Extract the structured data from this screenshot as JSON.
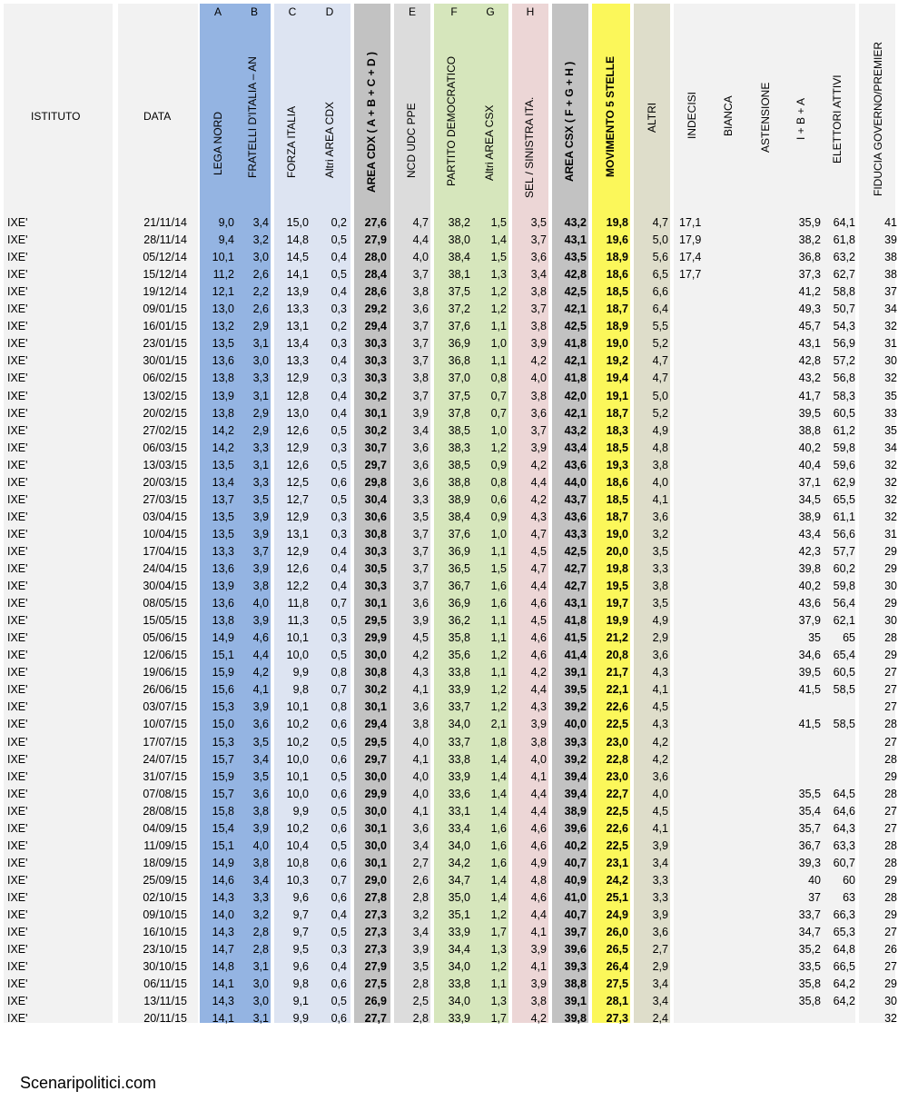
{
  "header": {
    "istituto": "ISTITUTO",
    "data": "DATA",
    "letters": {
      "A": "A",
      "B": "B",
      "C": "C",
      "D": "D",
      "E": "E",
      "F": "F",
      "G": "G",
      "H": "H"
    },
    "columns": {
      "lega": "LEGA NORD",
      "fdi": "FRATELLI D'ITALIA – AN",
      "fi": "FORZA ITALIA",
      "altri_cdx": "Altri AREA CDX",
      "area_cdx": "AREA CDX   ( A + B + C + D )",
      "ncd": "NCD UDC PPE",
      "pd": "PARTITO DEMOCRATICO",
      "altri_csx": "Altri AREA CSX",
      "sel": "SEL / SINISTRA ITA.",
      "area_csx": "AREA CSX   ( F + G + H )",
      "m5s": "MOVIMENTO 5 STELLE",
      "altri": "ALTRI",
      "indecisi": "INDECISI",
      "bianca": "BIANCA",
      "astensione": "ASTENSIONE",
      "iba": "I + B + A",
      "elettori": "ELETTORI ATTIVI",
      "fiducia": "FIDUCIA GOVERNO/PREMIER"
    }
  },
  "colors": {
    "lega_fdi": "#94b4e2",
    "fi_altri": "#dde4f2",
    "area_cdx": "#c2c2c2",
    "ncd": "#dcdcdc",
    "pd_altri": "#d6e6bc",
    "sel": "#ecd6d6",
    "area_csx": "#c2c2c2",
    "m5s": "#fbf75a",
    "altri": "#deddca",
    "right_bg": "#f2f2f2"
  },
  "rows": [
    [
      "IXE'",
      "21/11/14",
      "9,0",
      "3,4",
      "15,0",
      "0,2",
      "27,6",
      "4,7",
      "38,2",
      "1,5",
      "3,5",
      "43,2",
      "19,8",
      "4,7",
      "17,1",
      "",
      "",
      "35,9",
      "64,1",
      "41"
    ],
    [
      "IXE'",
      "28/11/14",
      "9,4",
      "3,2",
      "14,8",
      "0,5",
      "27,9",
      "4,4",
      "38,0",
      "1,4",
      "3,7",
      "43,1",
      "19,6",
      "5,0",
      "17,9",
      "",
      "",
      "38,2",
      "61,8",
      "39"
    ],
    [
      "IXE'",
      "05/12/14",
      "10,1",
      "3,0",
      "14,5",
      "0,4",
      "28,0",
      "4,0",
      "38,4",
      "1,5",
      "3,6",
      "43,5",
      "18,9",
      "5,6",
      "17,4",
      "",
      "",
      "36,8",
      "63,2",
      "38"
    ],
    [
      "IXE'",
      "15/12/14",
      "11,2",
      "2,6",
      "14,1",
      "0,5",
      "28,4",
      "3,7",
      "38,1",
      "1,3",
      "3,4",
      "42,8",
      "18,6",
      "6,5",
      "17,7",
      "",
      "",
      "37,3",
      "62,7",
      "38"
    ],
    [
      "IXE'",
      "19/12/14",
      "12,1",
      "2,2",
      "13,9",
      "0,4",
      "28,6",
      "3,8",
      "37,5",
      "1,2",
      "3,8",
      "42,5",
      "18,5",
      "6,6",
      "",
      "",
      "",
      "41,2",
      "58,8",
      "37"
    ],
    [
      "IXE'",
      "09/01/15",
      "13,0",
      "2,6",
      "13,3",
      "0,3",
      "29,2",
      "3,6",
      "37,2",
      "1,2",
      "3,7",
      "42,1",
      "18,7",
      "6,4",
      "",
      "",
      "",
      "49,3",
      "50,7",
      "34"
    ],
    [
      "IXE'",
      "16/01/15",
      "13,2",
      "2,9",
      "13,1",
      "0,2",
      "29,4",
      "3,7",
      "37,6",
      "1,1",
      "3,8",
      "42,5",
      "18,9",
      "5,5",
      "",
      "",
      "",
      "45,7",
      "54,3",
      "32"
    ],
    [
      "IXE'",
      "23/01/15",
      "13,5",
      "3,1",
      "13,4",
      "0,3",
      "30,3",
      "3,7",
      "36,9",
      "1,0",
      "3,9",
      "41,8",
      "19,0",
      "5,2",
      "",
      "",
      "",
      "43,1",
      "56,9",
      "31"
    ],
    [
      "IXE'",
      "30/01/15",
      "13,6",
      "3,0",
      "13,3",
      "0,4",
      "30,3",
      "3,7",
      "36,8",
      "1,1",
      "4,2",
      "42,1",
      "19,2",
      "4,7",
      "",
      "",
      "",
      "42,8",
      "57,2",
      "30"
    ],
    [
      "IXE'",
      "06/02/15",
      "13,8",
      "3,3",
      "12,9",
      "0,3",
      "30,3",
      "3,8",
      "37,0",
      "0,8",
      "4,0",
      "41,8",
      "19,4",
      "4,7",
      "",
      "",
      "",
      "43,2",
      "56,8",
      "32"
    ],
    [
      "IXE'",
      "13/02/15",
      "13,9",
      "3,1",
      "12,8",
      "0,4",
      "30,2",
      "3,7",
      "37,5",
      "0,7",
      "3,8",
      "42,0",
      "19,1",
      "5,0",
      "",
      "",
      "",
      "41,7",
      "58,3",
      "35"
    ],
    [
      "IXE'",
      "20/02/15",
      "13,8",
      "2,9",
      "13,0",
      "0,4",
      "30,1",
      "3,9",
      "37,8",
      "0,7",
      "3,6",
      "42,1",
      "18,7",
      "5,2",
      "",
      "",
      "",
      "39,5",
      "60,5",
      "33"
    ],
    [
      "IXE'",
      "27/02/15",
      "14,2",
      "2,9",
      "12,6",
      "0,5",
      "30,2",
      "3,4",
      "38,5",
      "1,0",
      "3,7",
      "43,2",
      "18,3",
      "4,9",
      "",
      "",
      "",
      "38,8",
      "61,2",
      "35"
    ],
    [
      "IXE'",
      "06/03/15",
      "14,2",
      "3,3",
      "12,9",
      "0,3",
      "30,7",
      "3,6",
      "38,3",
      "1,2",
      "3,9",
      "43,4",
      "18,5",
      "4,8",
      "",
      "",
      "",
      "40,2",
      "59,8",
      "34"
    ],
    [
      "IXE'",
      "13/03/15",
      "13,5",
      "3,1",
      "12,6",
      "0,5",
      "29,7",
      "3,6",
      "38,5",
      "0,9",
      "4,2",
      "43,6",
      "19,3",
      "3,8",
      "",
      "",
      "",
      "40,4",
      "59,6",
      "32"
    ],
    [
      "IXE'",
      "20/03/15",
      "13,4",
      "3,3",
      "12,5",
      "0,6",
      "29,8",
      "3,6",
      "38,8",
      "0,8",
      "4,4",
      "44,0",
      "18,6",
      "4,0",
      "",
      "",
      "",
      "37,1",
      "62,9",
      "32"
    ],
    [
      "IXE'",
      "27/03/15",
      "13,7",
      "3,5",
      "12,7",
      "0,5",
      "30,4",
      "3,3",
      "38,9",
      "0,6",
      "4,2",
      "43,7",
      "18,5",
      "4,1",
      "",
      "",
      "",
      "34,5",
      "65,5",
      "32"
    ],
    [
      "IXE'",
      "03/04/15",
      "13,5",
      "3,9",
      "12,9",
      "0,3",
      "30,6",
      "3,5",
      "38,4",
      "0,9",
      "4,3",
      "43,6",
      "18,7",
      "3,6",
      "",
      "",
      "",
      "38,9",
      "61,1",
      "32"
    ],
    [
      "IXE'",
      "10/04/15",
      "13,5",
      "3,9",
      "13,1",
      "0,3",
      "30,8",
      "3,7",
      "37,6",
      "1,0",
      "4,7",
      "43,3",
      "19,0",
      "3,2",
      "",
      "",
      "",
      "43,4",
      "56,6",
      "31"
    ],
    [
      "IXE'",
      "17/04/15",
      "13,3",
      "3,7",
      "12,9",
      "0,4",
      "30,3",
      "3,7",
      "36,9",
      "1,1",
      "4,5",
      "42,5",
      "20,0",
      "3,5",
      "",
      "",
      "",
      "42,3",
      "57,7",
      "29"
    ],
    [
      "IXE'",
      "24/04/15",
      "13,6",
      "3,9",
      "12,6",
      "0,4",
      "30,5",
      "3,7",
      "36,5",
      "1,5",
      "4,7",
      "42,7",
      "19,8",
      "3,3",
      "",
      "",
      "",
      "39,8",
      "60,2",
      "29"
    ],
    [
      "IXE'",
      "30/04/15",
      "13,9",
      "3,8",
      "12,2",
      "0,4",
      "30,3",
      "3,7",
      "36,7",
      "1,6",
      "4,4",
      "42,7",
      "19,5",
      "3,8",
      "",
      "",
      "",
      "40,2",
      "59,8",
      "30"
    ],
    [
      "IXE'",
      "08/05/15",
      "13,6",
      "4,0",
      "11,8",
      "0,7",
      "30,1",
      "3,6",
      "36,9",
      "1,6",
      "4,6",
      "43,1",
      "19,7",
      "3,5",
      "",
      "",
      "",
      "43,6",
      "56,4",
      "29"
    ],
    [
      "IXE'",
      "15/05/15",
      "13,8",
      "3,9",
      "11,3",
      "0,5",
      "29,5",
      "3,9",
      "36,2",
      "1,1",
      "4,5",
      "41,8",
      "19,9",
      "4,9",
      "",
      "",
      "",
      "37,9",
      "62,1",
      "30"
    ],
    [
      "IXE'",
      "05/06/15",
      "14,9",
      "4,6",
      "10,1",
      "0,3",
      "29,9",
      "4,5",
      "35,8",
      "1,1",
      "4,6",
      "41,5",
      "21,2",
      "2,9",
      "",
      "",
      "",
      "35",
      "65",
      "28"
    ],
    [
      "IXE'",
      "12/06/15",
      "15,1",
      "4,4",
      "10,0",
      "0,5",
      "30,0",
      "4,2",
      "35,6",
      "1,2",
      "4,6",
      "41,4",
      "20,8",
      "3,6",
      "",
      "",
      "",
      "34,6",
      "65,4",
      "29"
    ],
    [
      "IXE'",
      "19/06/15",
      "15,9",
      "4,2",
      "9,9",
      "0,8",
      "30,8",
      "4,3",
      "33,8",
      "1,1",
      "4,2",
      "39,1",
      "21,7",
      "4,3",
      "",
      "",
      "",
      "39,5",
      "60,5",
      "27"
    ],
    [
      "IXE'",
      "26/06/15",
      "15,6",
      "4,1",
      "9,8",
      "0,7",
      "30,2",
      "4,1",
      "33,9",
      "1,2",
      "4,4",
      "39,5",
      "22,1",
      "4,1",
      "",
      "",
      "",
      "41,5",
      "58,5",
      "27"
    ],
    [
      "IXE'",
      "03/07/15",
      "15,3",
      "3,9",
      "10,1",
      "0,8",
      "30,1",
      "3,6",
      "33,7",
      "1,2",
      "4,3",
      "39,2",
      "22,6",
      "4,5",
      "",
      "",
      "",
      "",
      "",
      "27"
    ],
    [
      "IXE'",
      "10/07/15",
      "15,0",
      "3,6",
      "10,2",
      "0,6",
      "29,4",
      "3,8",
      "34,0",
      "2,1",
      "3,9",
      "40,0",
      "22,5",
      "4,3",
      "",
      "",
      "",
      "41,5",
      "58,5",
      "28"
    ],
    [
      "IXE'",
      "17/07/15",
      "15,3",
      "3,5",
      "10,2",
      "0,5",
      "29,5",
      "4,0",
      "33,7",
      "1,8",
      "3,8",
      "39,3",
      "23,0",
      "4,2",
      "",
      "",
      "",
      "",
      "",
      "27"
    ],
    [
      "IXE'",
      "24/07/15",
      "15,7",
      "3,4",
      "10,0",
      "0,6",
      "29,7",
      "4,1",
      "33,8",
      "1,4",
      "4,0",
      "39,2",
      "22,8",
      "4,2",
      "",
      "",
      "",
      "",
      "",
      "28"
    ],
    [
      "IXE'",
      "31/07/15",
      "15,9",
      "3,5",
      "10,1",
      "0,5",
      "30,0",
      "4,0",
      "33,9",
      "1,4",
      "4,1",
      "39,4",
      "23,0",
      "3,6",
      "",
      "",
      "",
      "",
      "",
      "29"
    ],
    [
      "IXE'",
      "07/08/15",
      "15,7",
      "3,6",
      "10,0",
      "0,6",
      "29,9",
      "4,0",
      "33,6",
      "1,4",
      "4,4",
      "39,4",
      "22,7",
      "4,0",
      "",
      "",
      "",
      "35,5",
      "64,5",
      "28"
    ],
    [
      "IXE'",
      "28/08/15",
      "15,8",
      "3,8",
      "9,9",
      "0,5",
      "30,0",
      "4,1",
      "33,1",
      "1,4",
      "4,4",
      "38,9",
      "22,5",
      "4,5",
      "",
      "",
      "",
      "35,4",
      "64,6",
      "27"
    ],
    [
      "IXE'",
      "04/09/15",
      "15,4",
      "3,9",
      "10,2",
      "0,6",
      "30,1",
      "3,6",
      "33,4",
      "1,6",
      "4,6",
      "39,6",
      "22,6",
      "4,1",
      "",
      "",
      "",
      "35,7",
      "64,3",
      "27"
    ],
    [
      "IXE'",
      "11/09/15",
      "15,1",
      "4,0",
      "10,4",
      "0,5",
      "30,0",
      "3,4",
      "34,0",
      "1,6",
      "4,6",
      "40,2",
      "22,5",
      "3,9",
      "",
      "",
      "",
      "36,7",
      "63,3",
      "28"
    ],
    [
      "IXE'",
      "18/09/15",
      "14,9",
      "3,8",
      "10,8",
      "0,6",
      "30,1",
      "2,7",
      "34,2",
      "1,6",
      "4,9",
      "40,7",
      "23,1",
      "3,4",
      "",
      "",
      "",
      "39,3",
      "60,7",
      "28"
    ],
    [
      "IXE'",
      "25/09/15",
      "14,6",
      "3,4",
      "10,3",
      "0,7",
      "29,0",
      "2,6",
      "34,7",
      "1,4",
      "4,8",
      "40,9",
      "24,2",
      "3,3",
      "",
      "",
      "",
      "40",
      "60",
      "29"
    ],
    [
      "IXE'",
      "02/10/15",
      "14,3",
      "3,3",
      "9,6",
      "0,6",
      "27,8",
      "2,8",
      "35,0",
      "1,4",
      "4,6",
      "41,0",
      "25,1",
      "3,3",
      "",
      "",
      "",
      "37",
      "63",
      "28"
    ],
    [
      "IXE'",
      "09/10/15",
      "14,0",
      "3,2",
      "9,7",
      "0,4",
      "27,3",
      "3,2",
      "35,1",
      "1,2",
      "4,4",
      "40,7",
      "24,9",
      "3,9",
      "",
      "",
      "",
      "33,7",
      "66,3",
      "29"
    ],
    [
      "IXE'",
      "16/10/15",
      "14,3",
      "2,8",
      "9,7",
      "0,5",
      "27,3",
      "3,4",
      "33,9",
      "1,7",
      "4,1",
      "39,7",
      "26,0",
      "3,6",
      "",
      "",
      "",
      "34,7",
      "65,3",
      "27"
    ],
    [
      "IXE'",
      "23/10/15",
      "14,7",
      "2,8",
      "9,5",
      "0,3",
      "27,3",
      "3,9",
      "34,4",
      "1,3",
      "3,9",
      "39,6",
      "26,5",
      "2,7",
      "",
      "",
      "",
      "35,2",
      "64,8",
      "26"
    ],
    [
      "IXE'",
      "30/10/15",
      "14,8",
      "3,1",
      "9,6",
      "0,4",
      "27,9",
      "3,5",
      "34,0",
      "1,2",
      "4,1",
      "39,3",
      "26,4",
      "2,9",
      "",
      "",
      "",
      "33,5",
      "66,5",
      "27"
    ],
    [
      "IXE'",
      "06/11/15",
      "14,1",
      "3,0",
      "9,8",
      "0,6",
      "27,5",
      "2,8",
      "33,8",
      "1,1",
      "3,9",
      "38,8",
      "27,5",
      "3,4",
      "",
      "",
      "",
      "35,8",
      "64,2",
      "29"
    ],
    [
      "IXE'",
      "13/11/15",
      "14,3",
      "3,0",
      "9,1",
      "0,5",
      "26,9",
      "2,5",
      "34,0",
      "1,3",
      "3,8",
      "39,1",
      "28,1",
      "3,4",
      "",
      "",
      "",
      "35,8",
      "64,2",
      "30"
    ],
    [
      "IXE'",
      "20/11/15",
      "14,1",
      "3,1",
      "9,9",
      "0,6",
      "27,7",
      "2,8",
      "33,9",
      "1,7",
      "4,2",
      "39,8",
      "27,3",
      "2,4",
      "",
      "",
      "",
      "",
      "",
      "32"
    ]
  ],
  "footer": "Scenaripolitici.com"
}
